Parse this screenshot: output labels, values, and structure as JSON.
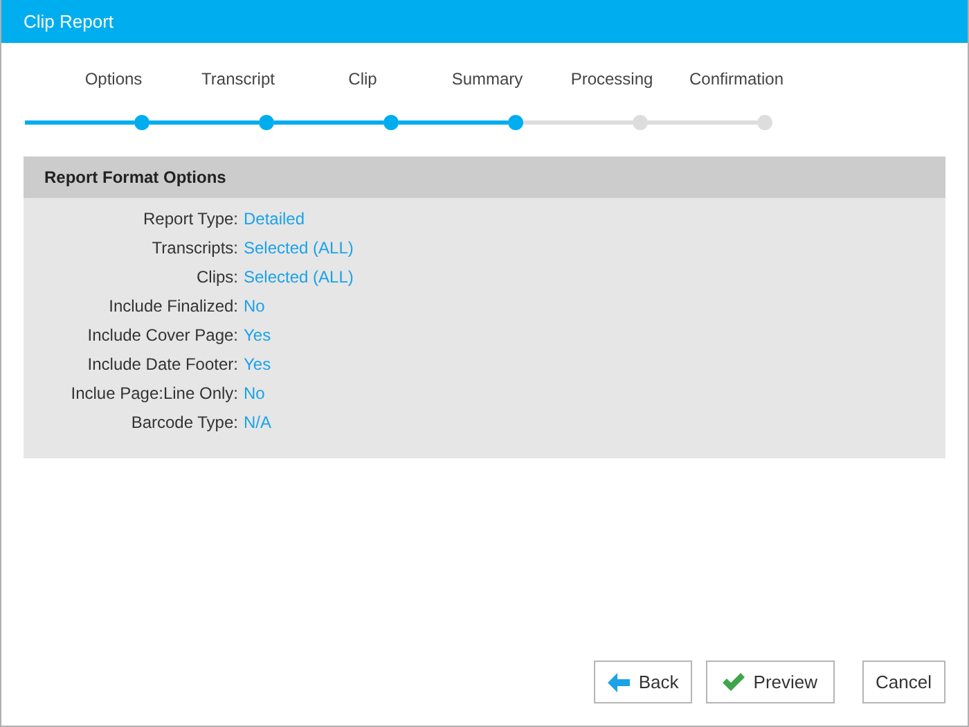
{
  "window": {
    "title": "Clip Report"
  },
  "steps": [
    {
      "label": "Options",
      "done": true
    },
    {
      "label": "Transcript",
      "done": true
    },
    {
      "label": "Clip",
      "done": true
    },
    {
      "label": "Summary",
      "done": true
    },
    {
      "label": "Processing",
      "done": false
    },
    {
      "label": "Confirmation",
      "done": false
    }
  ],
  "panel": {
    "title": "Report Format Options",
    "rows": [
      {
        "label": "Report Type:",
        "value": "Detailed"
      },
      {
        "label": "Transcripts:",
        "value": "Selected (ALL)"
      },
      {
        "label": "Clips:",
        "value": "Selected (ALL)"
      },
      {
        "label": "Include Finalized:",
        "value": "No"
      },
      {
        "label": "Include Cover Page:",
        "value": "Yes"
      },
      {
        "label": "Include Date Footer:",
        "value": "Yes"
      },
      {
        "label": "Inclue Page:Line Only:",
        "value": "No"
      },
      {
        "label": "Barcode Type:",
        "value": "N/A"
      }
    ]
  },
  "buttons": [
    {
      "kind": "back",
      "label": "Back"
    },
    {
      "kind": "preview",
      "label": "Preview"
    },
    {
      "kind": "cancel",
      "label": "Cancel"
    }
  ]
}
